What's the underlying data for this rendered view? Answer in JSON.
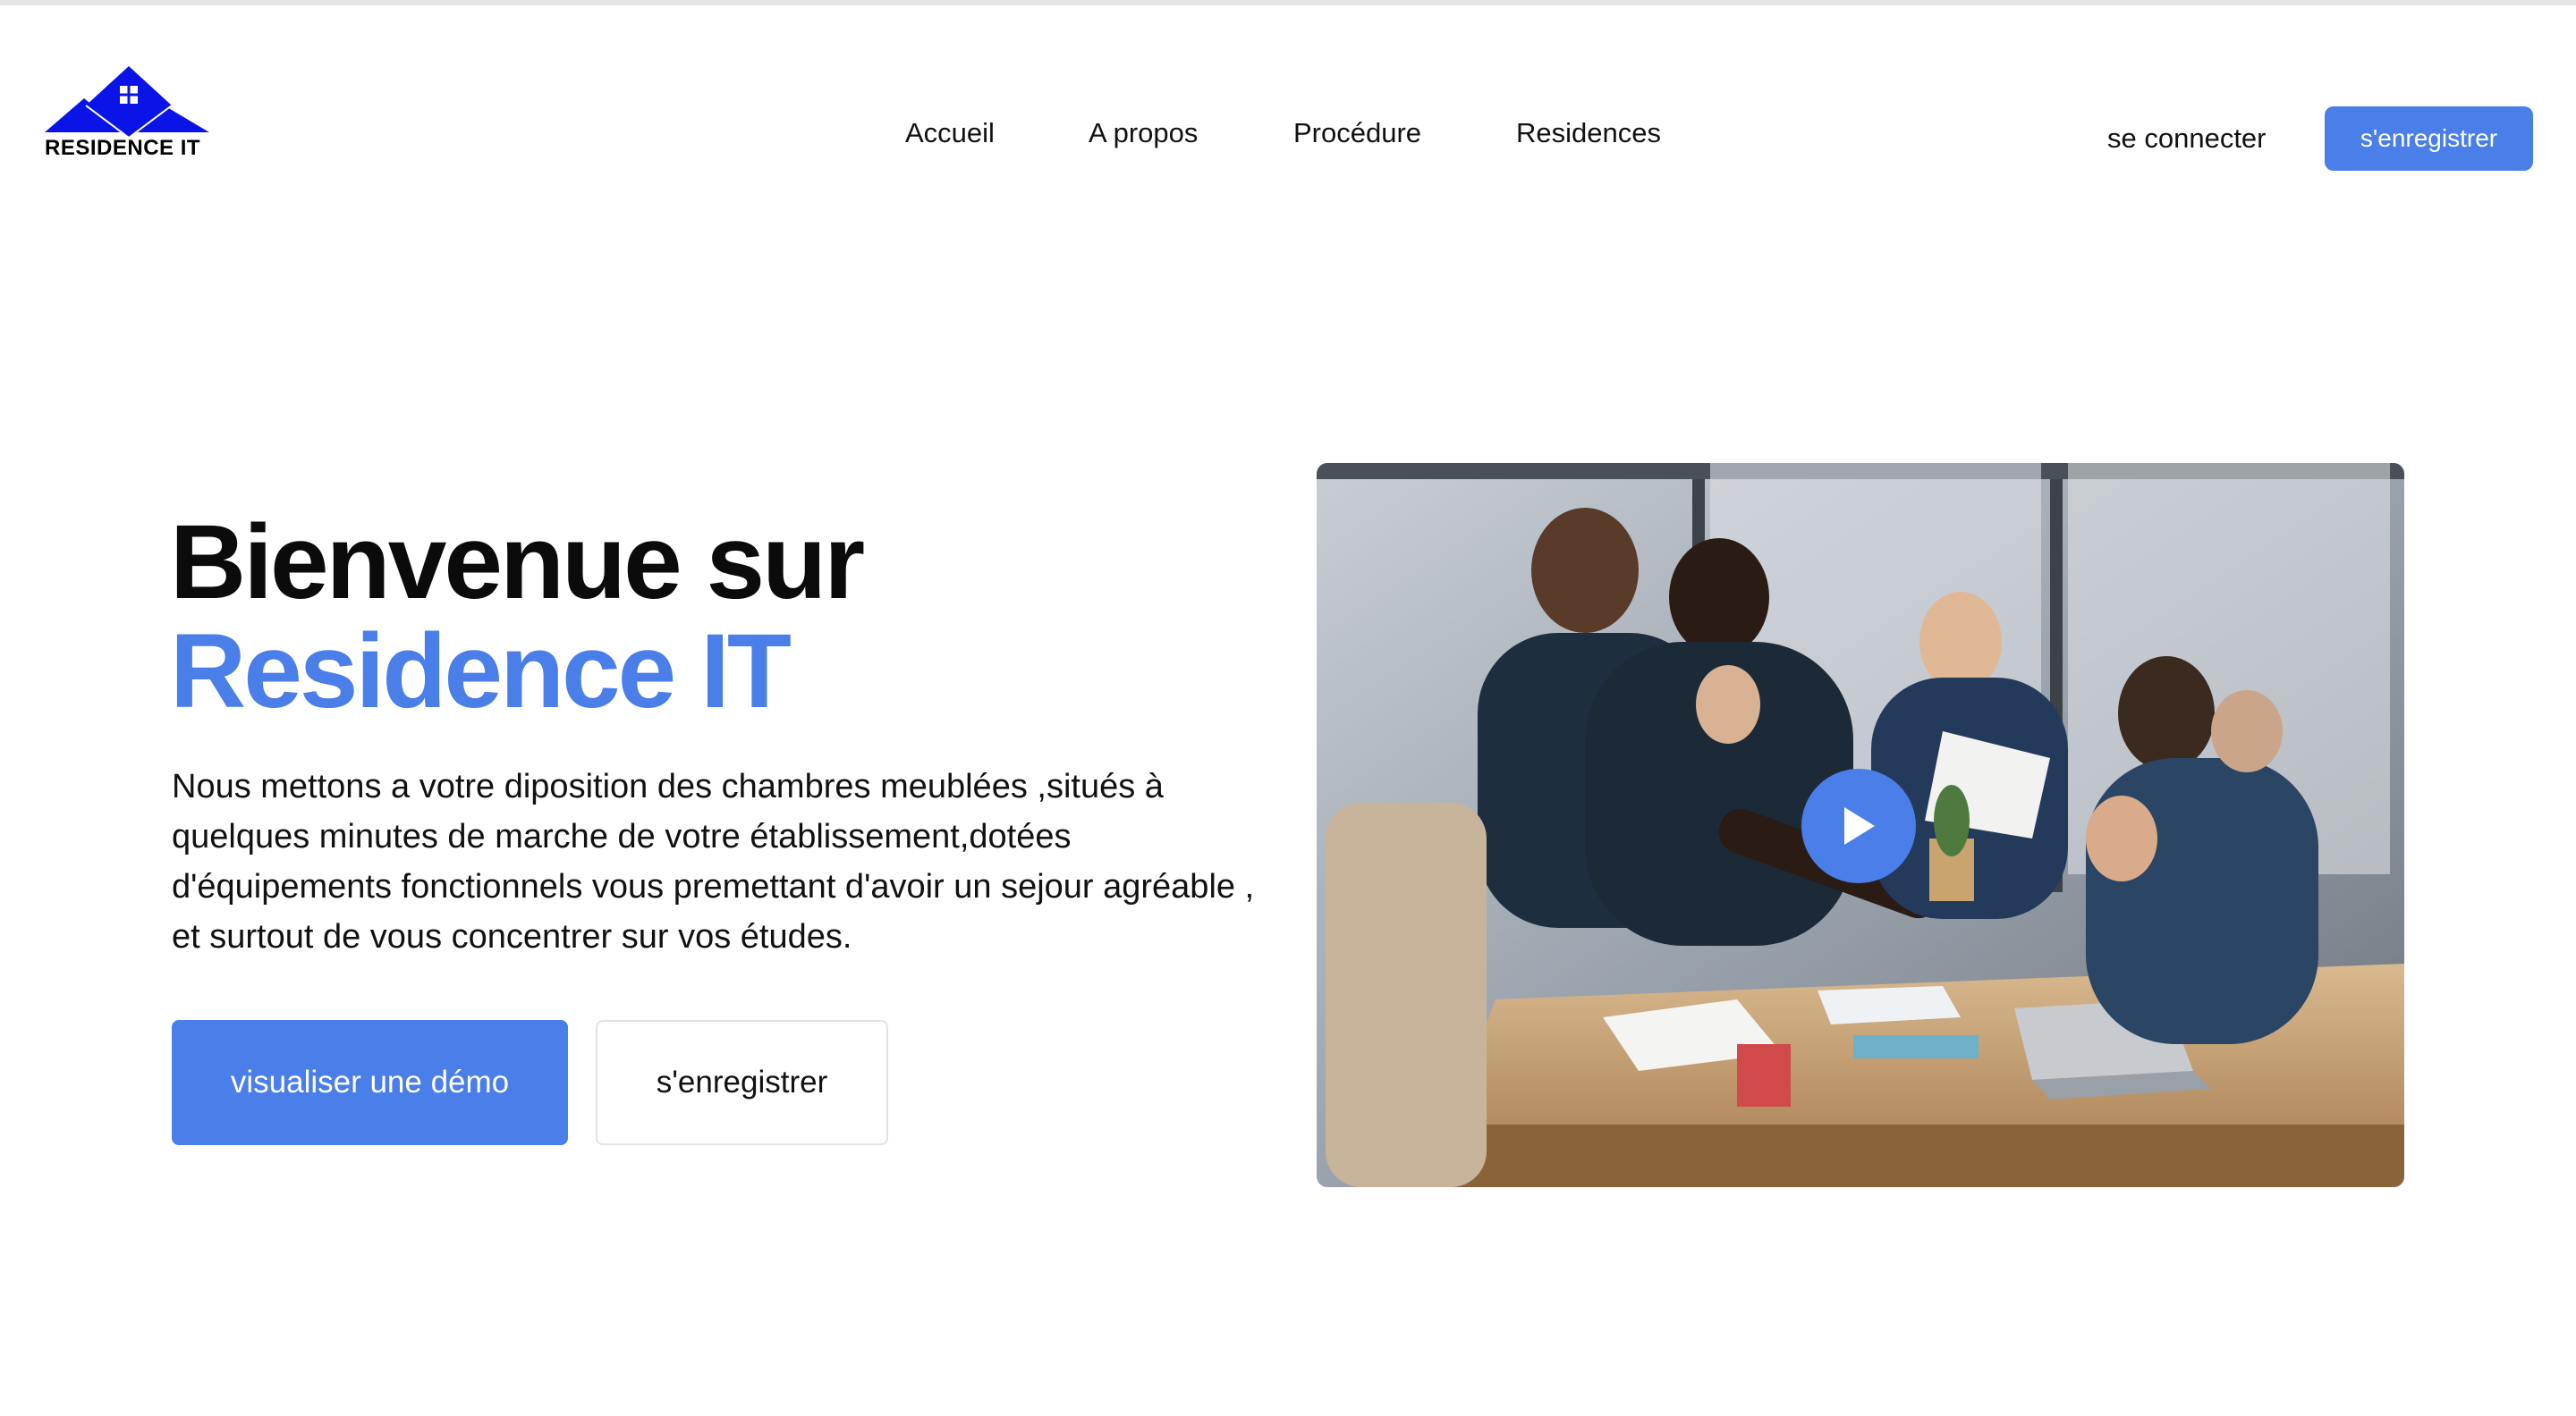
{
  "header": {
    "logo_text": "RESIDENCE IT",
    "nav": [
      {
        "label": "Accueil"
      },
      {
        "label": "A propos"
      },
      {
        "label": "Procédure"
      },
      {
        "label": "Residences"
      }
    ],
    "login_label": "se connecter",
    "register_label": "s'enregistrer"
  },
  "hero": {
    "title_line1": "Bienvenue sur",
    "title_line2": "Residence IT",
    "description": "Nous mettons a votre diposition des chambres meublées ,situés à quelques minutes de marche de votre établissement,dotées d'équipements fonctionnels vous premettant d'avoir un sejour agréable , et surtout de vous concentrer sur vos études.",
    "demo_button": "visualiser une démo",
    "register_button": "s'enregistrer"
  },
  "media": {
    "type": "video",
    "icon": "play-icon"
  },
  "colors": {
    "accent": "#4a7ee8",
    "logo_blue": "#0a14e6",
    "text": "#111111"
  }
}
